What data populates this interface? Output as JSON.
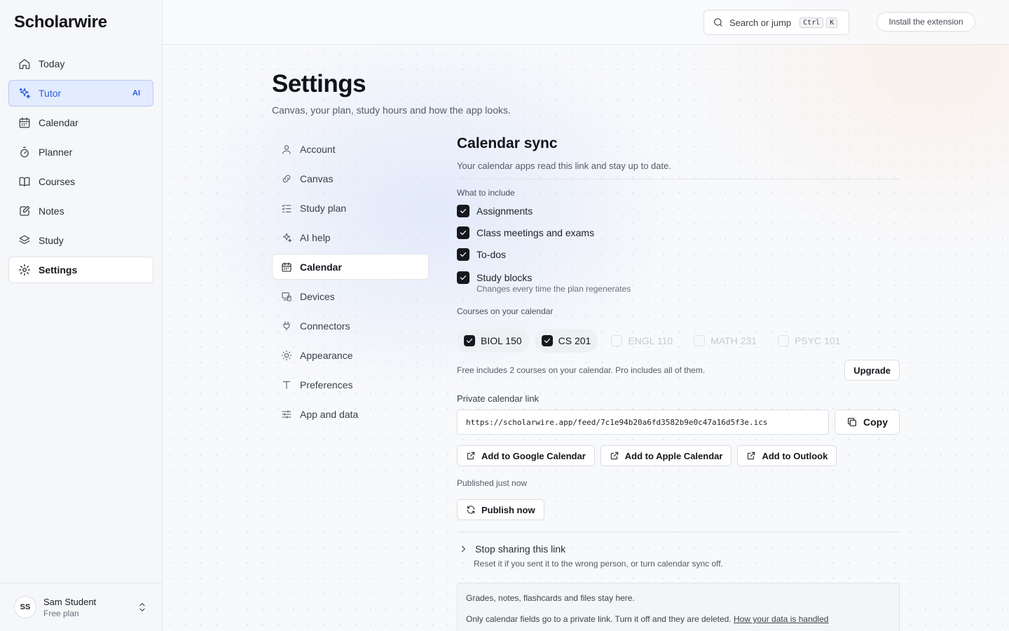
{
  "app": {
    "brand": "Scholarwire"
  },
  "sidebar": {
    "items": [
      {
        "label": "Today",
        "icon": "home-icon"
      },
      {
        "label": "Tutor",
        "icon": "sparkles-icon",
        "badge": "AI"
      },
      {
        "label": "Calendar",
        "icon": "calendar-icon"
      },
      {
        "label": "Planner",
        "icon": "timer-icon"
      },
      {
        "label": "Courses",
        "icon": "book-icon"
      },
      {
        "label": "Notes",
        "icon": "note-icon"
      },
      {
        "label": "Study",
        "icon": "layers-icon"
      },
      {
        "label": "Settings",
        "icon": "gear-icon"
      }
    ],
    "user": {
      "initials": "SS",
      "name": "Sam Student",
      "plan": "Free plan"
    }
  },
  "topbar": {
    "search_label": "Search or jump",
    "kbd1": "Ctrl",
    "kbd2": "K",
    "install_label": "Install the extension"
  },
  "page": {
    "title": "Settings",
    "subtitle": "Canvas, your plan, study hours and how the app looks."
  },
  "subnav": {
    "items": [
      {
        "label": "Account"
      },
      {
        "label": "Canvas"
      },
      {
        "label": "Study plan"
      },
      {
        "label": "AI help"
      },
      {
        "label": "Calendar"
      },
      {
        "label": "Devices"
      },
      {
        "label": "Connectors"
      },
      {
        "label": "Appearance"
      },
      {
        "label": "Preferences"
      },
      {
        "label": "App and data"
      }
    ],
    "active": "Calendar"
  },
  "calendar": {
    "title": "Calendar sync",
    "subtitle": "Your calendar apps read this link and stay up to date.",
    "include_label": "What to include",
    "include": [
      {
        "label": "Assignments",
        "checked": true
      },
      {
        "label": "Class meetings and exams",
        "checked": true
      },
      {
        "label": "To-dos",
        "checked": true
      },
      {
        "label": "Study blocks",
        "checked": true,
        "hint": "Changes every time the plan regenerates"
      }
    ],
    "courses_label": "Courses on your calendar",
    "courses": [
      {
        "label": "BIOL 150",
        "checked": true
      },
      {
        "label": "CS 201",
        "checked": true
      },
      {
        "label": "ENGL 110",
        "checked": false
      },
      {
        "label": "MATH 231",
        "checked": false
      },
      {
        "label": "PSYC 101",
        "checked": false
      }
    ],
    "plan_note": "Free includes 2 courses on your calendar. Pro includes all of them.",
    "upgrade_label": "Upgrade",
    "link_label": "Private calendar link",
    "link_value": "https://scholarwire.app/feed/7c1e94b20a6fd3582b9e0c47a16d5f3e.ics",
    "copy_label": "Copy",
    "add_google": "Add to Google Calendar",
    "add_apple": "Add to Apple Calendar",
    "add_outlook": "Add to Outlook",
    "published": "Published just now",
    "publish_label": "Publish now",
    "stop_label": "Stop sharing this link",
    "stop_sub": "Reset it if you sent it to the wrong person, or turn calendar sync off.",
    "info1": "Grades, notes, flashcards and files stay here.",
    "info2": "Only calendar fields go to a private link. Turn it off and they are deleted.",
    "info_link": "How your data is handled"
  }
}
